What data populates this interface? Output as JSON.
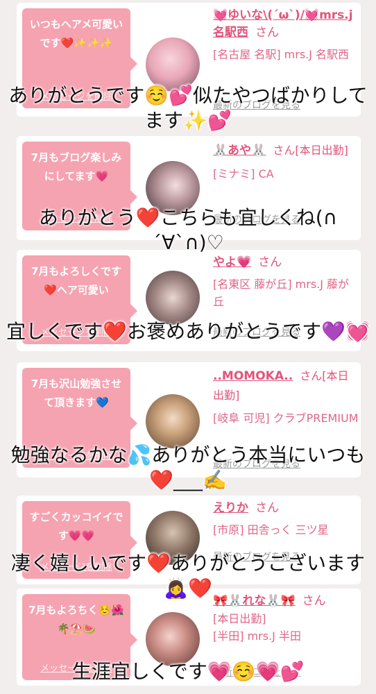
{
  "cards": [
    {
      "bubble": "いつもヘアメ可愛いです❤️✨✨✨",
      "delete_label": "メッセージを削除",
      "name": "💓ゆいな\\(ˊωˋ)/💓mrs.j名駅西",
      "san": "さん",
      "location": "[名古屋 名駅] mrs.J 名駅西",
      "blog_label": "最新のブログを見る",
      "overlay": "ありがとうです☺️💕似たやつばかりしてます✨💕"
    },
    {
      "bubble": "7月もブログ楽しみにしてます💗",
      "delete_label": "メッセージを削除",
      "name": "🐰あや🐰",
      "san": "さん[本日出勤]",
      "location": "[ミナミ] CA",
      "blog_label": "最新のブログを見る",
      "overlay": "ありがとう❤️こちらも宜しくね(∩´∀`∩)♡"
    },
    {
      "bubble": "7月もよろしくです❤️ヘア可愛い",
      "delete_label": "メッセージを削除",
      "name": "やよ💗",
      "san": "さん",
      "location": "[名東区 藤が丘] mrs.J 藤が丘",
      "blog_label": "最新のブログを見る",
      "overlay": "宜しくです❤️お褒めありがとうです💜💓"
    },
    {
      "bubble": "7月も沢山勉強させて頂きます💙",
      "delete_label": "メッセージを削除",
      "name": "..MOMOKA..",
      "san": "さん[本日出勤]",
      "location": "[岐阜 可児] クラブPREMIUM",
      "blog_label": "最新のブログを見る",
      "overlay": "勉強なるかな💦ありがとう本当にいつも❤️___✍️"
    },
    {
      "bubble": "すごくカッコイイです💗💗",
      "delete_label": "メッセージを削除",
      "name": "えりか",
      "san": "さん",
      "location": "[市原] 田舎っく 三ツ星",
      "blog_label": "最新のブログを見る",
      "overlay": "凄く嬉しいです❤️ありがとうございます🙇‍♀️❤️"
    },
    {
      "bubble": "7月もよろちく☺️🌺🌴⛱️🍉",
      "delete_label": "メッセージを削除",
      "name": "🎀🐰れな🐰🎀",
      "san": "さん",
      "location_1": "[本日出勤]",
      "location_2": "[半田] mrs.J 半田",
      "blog_label": "最新のブログを見る",
      "overlay": "生涯宜しくです💗☺️💗💕"
    }
  ],
  "colors": {
    "bubble": "#f5a3b1",
    "name": "#e2547c",
    "background": "#f2eeee"
  }
}
